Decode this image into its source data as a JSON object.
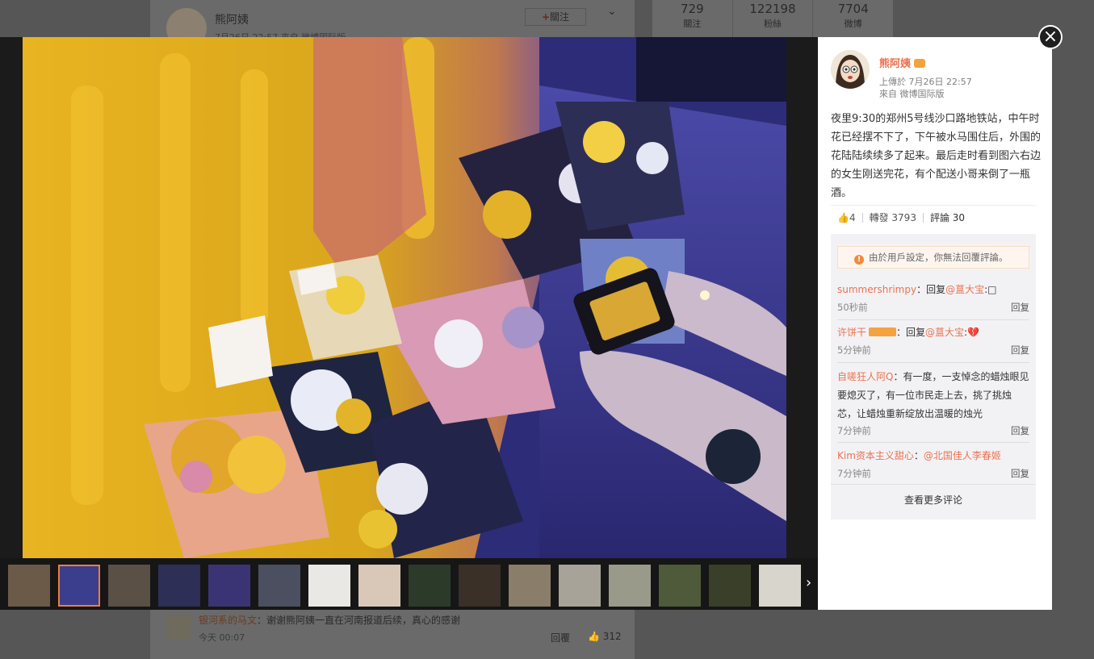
{
  "background": {
    "stats": [
      {
        "value": "729",
        "label": "關注"
      },
      {
        "value": "122198",
        "label": "粉絲"
      },
      {
        "value": "7704",
        "label": "微博"
      }
    ],
    "author_name": "熊阿姨",
    "post_meta": "7月26日 22:57 来自 微博国际版",
    "follow_label": "關注",
    "comment": {
      "user": "银河系的马文",
      "text": "：谢谢熊阿姨一直在河南报道后续，真心的感谢",
      "time": "今天 00:07",
      "reply_label": "回覆",
      "likes": "312"
    }
  },
  "lightbox": {
    "close_label": "×",
    "next_label": "›",
    "thumbnail_count": 16,
    "active_thumbnail": 2
  },
  "panel": {
    "author": "熊阿姨",
    "upload_time": "上傳於 7月26日 22:57",
    "source": "來自 微博国际版",
    "text": "夜里9:30的郑州5号线沙口路地铁站，中午时花已经摆不下了，下午被水马围住后，外围的花陆陆续续多了起来。最后走时看到图六右边的女生刚送完花，有个配送小哥来倒了一瓶酒。",
    "likes": "4",
    "repost_label": "轉發 3793",
    "comment_label": "評論 30",
    "notice": "由於用戶設定，你無法回覆評論。",
    "comments": [
      {
        "user": "summershrimpy",
        "pre": "：回复",
        "mention": "@蒀大宝",
        "post": ":□",
        "time": "50秒前",
        "reply": "回复"
      },
      {
        "user": "许饼干",
        "pre": "：回复",
        "mention": "@蒀大宝",
        "post": ":💔",
        "time": "5分钟前",
        "reply": "回复"
      },
      {
        "user": "自嗟狂人阿Q",
        "text": "：有一度，一支悼念的蜡烛眼见要熄灭了，有一位市民走上去，挑了挑烛芯，让蜡烛重新绽放出温暖的烛光",
        "time": "7分钟前",
        "reply": "回复"
      },
      {
        "user": "Kim资本主义甜心",
        "pre": "：",
        "mention": "@北国佳人李春姬",
        "time": "7分钟前",
        "reply": "回复"
      }
    ],
    "more_label": "查看更多评论"
  },
  "colors": {
    "accent": "#eb7350",
    "active_thumb": "#f07f3a"
  }
}
